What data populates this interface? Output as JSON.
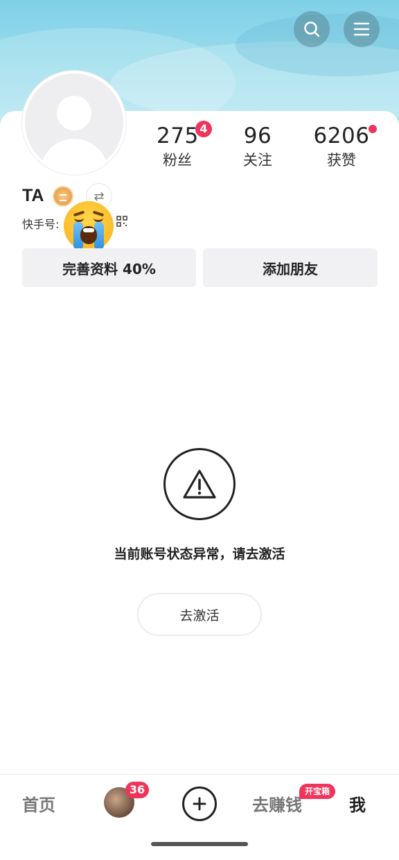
{
  "header": {
    "search_icon": "search-icon",
    "menu_icon": "menu-icon"
  },
  "profile": {
    "username": "TA",
    "kwai_id_label": "快手号:",
    "stats": {
      "fans_count": "275",
      "fans_badge": "4",
      "fans_label": "粉丝",
      "follow_count": "96",
      "follow_label": "关注",
      "likes_count": "6206",
      "likes_label": "获赞"
    },
    "switch_icon": "⇄"
  },
  "actions": {
    "edit_profile": "完善资料 40%",
    "add_friend": "添加朋友"
  },
  "notice": {
    "message": "当前账号状态异常，请去激活",
    "activate_button": "去激活"
  },
  "nav": {
    "home": "首页",
    "avatar_badge": "36",
    "earn": "去赚钱",
    "earn_badge": "开宝箱",
    "me": "我"
  },
  "colors": {
    "accent": "#f0355d",
    "header_bg": "#9adcec"
  }
}
